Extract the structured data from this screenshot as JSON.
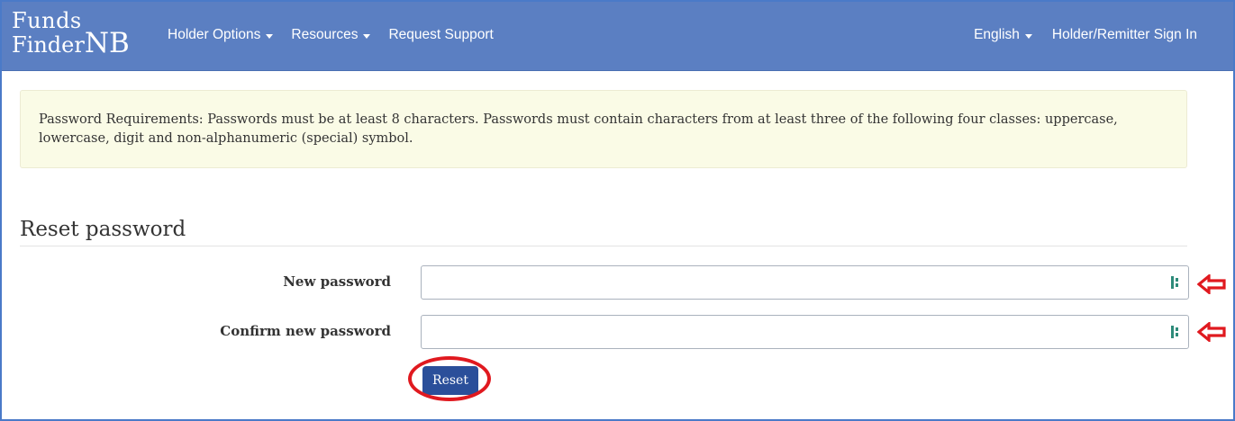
{
  "navbar": {
    "brand_line1": "Funds",
    "brand_line2a": "Finder",
    "brand_line2b": "NB",
    "left_items": [
      {
        "label": "Holder Options"
      },
      {
        "label": "Resources"
      },
      {
        "label": "Request Support"
      }
    ],
    "language": "English",
    "sign_in": "Holder/Remitter Sign In"
  },
  "alert": {
    "text": "Password Requirements: Passwords must be at least 8 characters. Passwords must contain characters from at least three of the following four classes: uppercase, lowercase, digit and non-alphanumeric (special) symbol."
  },
  "form": {
    "heading": "Reset password",
    "new_password_label": "New password",
    "new_password_value": "",
    "confirm_password_label": "Confirm new password",
    "confirm_password_value": "",
    "reset_label": "Reset"
  },
  "colors": {
    "navbar": "#5b7fc2",
    "annotation_red": "#e0191f",
    "button": "#2b4f9a",
    "alert_bg": "#fafbe6"
  }
}
